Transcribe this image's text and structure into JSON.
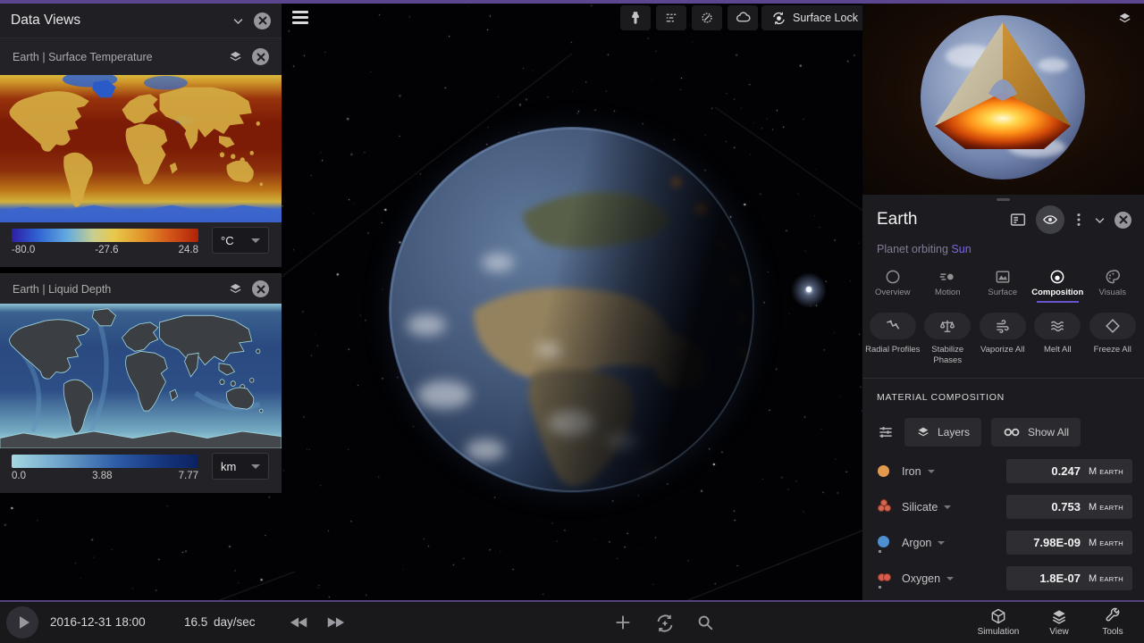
{
  "accent_colors": {
    "top_border": "#5a4790",
    "tab_underline": "#6a53c8",
    "link_purple": "#7f66e3"
  },
  "data_views": {
    "title": "Data Views",
    "views": [
      {
        "name": "Earth  |  Surface Temperature",
        "unit": "°C",
        "scale_min": "-80.0",
        "scale_mid": "-27.6",
        "scale_max": "24.8"
      },
      {
        "name": "Earth  |  Liquid Depth",
        "unit": "km",
        "scale_min": "0.0",
        "scale_mid": "3.88",
        "scale_max": "7.77"
      }
    ]
  },
  "viewport": {
    "surface_lock": "Surface Lock"
  },
  "planet_panel": {
    "title": "Earth",
    "subtitle": "Planet orbiting",
    "subtitle_target": "Sun",
    "tabs": [
      {
        "label": "Overview"
      },
      {
        "label": "Motion"
      },
      {
        "label": "Surface"
      },
      {
        "label": "Composition",
        "active": true
      },
      {
        "label": "Visuals"
      }
    ],
    "actions": [
      {
        "label": "Radial Profiles"
      },
      {
        "label": "Stabilize Phases"
      },
      {
        "label": "Vaporize All"
      },
      {
        "label": "Melt All"
      },
      {
        "label": "Freeze All"
      }
    ],
    "section": "MATERIAL COMPOSITION",
    "layers_button": "Layers",
    "show_all_button": "Show All",
    "unit_prefix": "M",
    "unit_suffix": "EARTH",
    "materials": [
      {
        "name": "Iron",
        "value": "0.247",
        "color": "#e29a4e"
      },
      {
        "name": "Silicate",
        "value": "0.753",
        "color": "#d2674f"
      },
      {
        "name": "Argon",
        "value": "7.98E-09",
        "color": "#4e8fd0"
      },
      {
        "name": "Oxygen",
        "value": "1.8E-07",
        "color": "#d85c4e"
      }
    ]
  },
  "time_bar": {
    "datetime": "2016-12-31 18:00",
    "speed": "16.5",
    "speed_unit": "day/sec",
    "menus": [
      {
        "label": "Simulation"
      },
      {
        "label": "View"
      },
      {
        "label": "Tools"
      }
    ]
  }
}
